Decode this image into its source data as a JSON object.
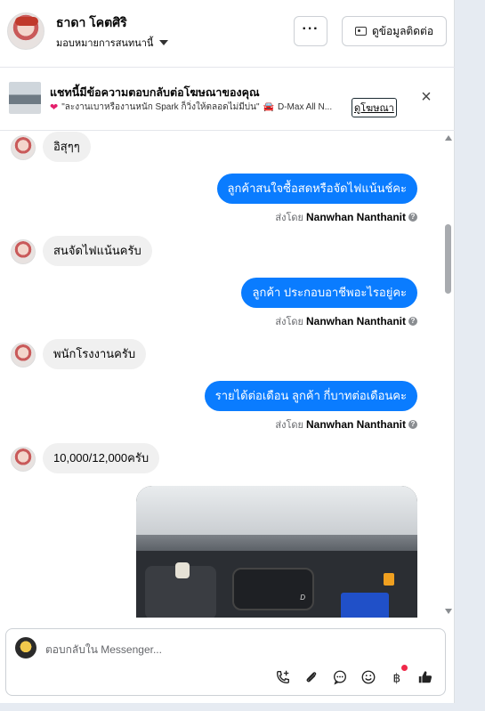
{
  "header": {
    "contact_name": "ธาดา โคตศิริ",
    "assign_label": "มอบหมายการสนทนานี้",
    "more_label": "···",
    "contact_info_label": "ดูข้อมูลติดต่อ"
  },
  "ad_banner": {
    "title": "แชทนี้มีข้อความตอบกลับต่อโฆษณาของคุณ",
    "ad_text": "\"ละงานเบาหรืองานหนัก Spark ก็วิ่งให้ตลอดไม่มีบ่น\"",
    "ad_model": "D-Max All N...",
    "view_ad_label": "ดูโฆษณา",
    "close_label": "×"
  },
  "messages": {
    "in_1": "อิสุๆๆ",
    "out_1": "ลูกค้าสนใจซื้อสดหรือจัดไฟแน้นช์คะ",
    "in_2": "สนจัดไฟแน้นครับ",
    "out_2": "ลูกค้า ประกอบอาชีพอะไรอยู่คะ",
    "in_3": "พนักโรงงานครับ",
    "out_3": "รายได้ต่อเดือน ลูกค้า กี่บาทต่อเดือนคะ",
    "in_4": "10,000/12,000ครับ",
    "sent_by_prefix": "ส่งโดย",
    "sender_name": "Nanwhan Nanthanit"
  },
  "composer": {
    "placeholder": "ตอบกลับใน Messenger..."
  },
  "icons": [
    "call-add-icon",
    "attachment-icon",
    "saved-reply-icon",
    "emoji-icon",
    "baht-icon",
    "like-icon"
  ],
  "colors": {
    "outgoing_bubble": "#0a7cff",
    "incoming_bubble": "#f0f0f0"
  }
}
